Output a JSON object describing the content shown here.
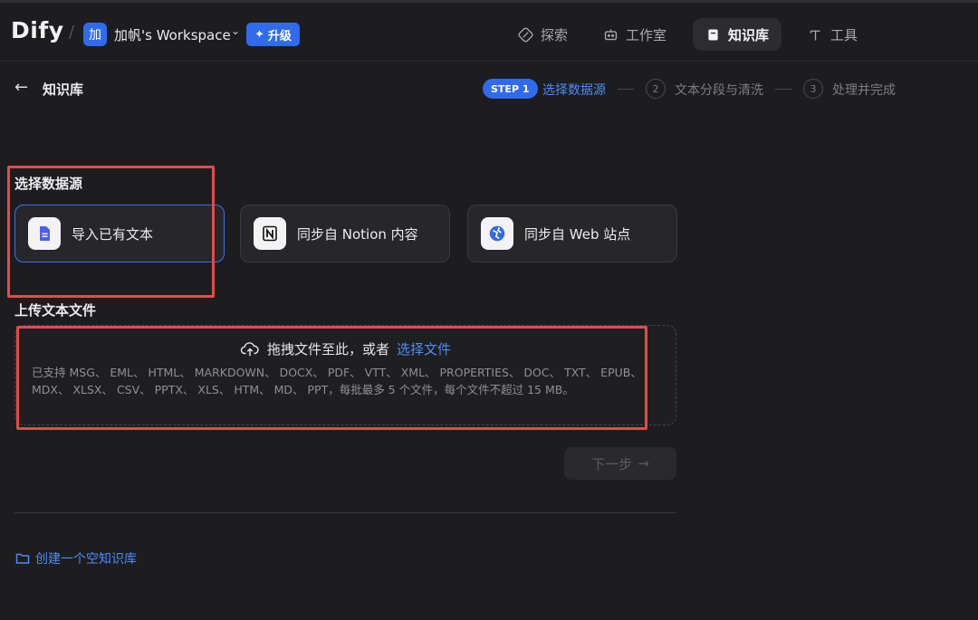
{
  "header": {
    "logo": "Dify",
    "workspace_avatar": "加",
    "workspace_name": "加帆's Workspace",
    "upgrade_label": "升级",
    "nav": [
      {
        "label": "探索",
        "icon": "compass-icon"
      },
      {
        "label": "工作室",
        "icon": "robot-icon"
      },
      {
        "label": "知识库",
        "icon": "book-icon",
        "active": true
      },
      {
        "label": "工具",
        "icon": "hammer-icon"
      }
    ]
  },
  "subheader": {
    "back_label": "知识库",
    "steps": [
      {
        "badge": "STEP 1",
        "label": "选择数据源",
        "active": true
      },
      {
        "number": "2",
        "label": "文本分段与清洗"
      },
      {
        "number": "3",
        "label": "处理并完成"
      }
    ]
  },
  "datasource": {
    "title": "选择数据源",
    "options": [
      {
        "label": "导入已有文本",
        "icon": "document-icon",
        "selected": true
      },
      {
        "label": "同步自 Notion 内容",
        "icon": "notion-icon"
      },
      {
        "label": "同步自 Web 站点",
        "icon": "globe-icon"
      }
    ]
  },
  "upload": {
    "title": "上传文本文件",
    "headline": "拖拽文件至此，或者",
    "link": "选择文件",
    "description": "已支持 MSG、 EML、 HTML、 MARKDOWN、 DOCX、 PDF、 VTT、 XML、 PROPERTIES、 DOC、 TXT、 EPUB、 MDX、 XLSX、 CSV、 PPTX、 XLS、 HTM、 MD、 PPT，每批最多 5 个文件，每个文件不超过 15 MB。"
  },
  "next_label": "下一步",
  "create_empty_label": "创建一个空知识库",
  "colors": {
    "accent": "#2f6bec",
    "link": "#4d8cf5",
    "highlight": "#e54b4b",
    "background": "#1d1d20"
  }
}
